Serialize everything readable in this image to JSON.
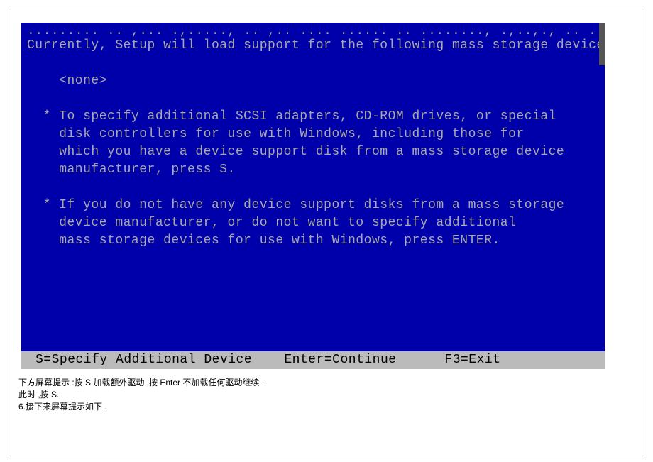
{
  "setup": {
    "cutoff": "......... .. ,... .,....., .. ,.. .... ...... .. ........, .,..,., .. ..,....",
    "line1": "Currently, Setup will load support for the following mass storage devices(s):",
    "line2": "    <none>",
    "bullet1_1": "  * To specify additional SCSI adapters, CD-ROM drives, or special",
    "bullet1_2": "    disk controllers for use with Windows, including those for",
    "bullet1_3": "    which you have a device support disk from a mass storage device",
    "bullet1_4": "    manufacturer, press S.",
    "bullet2_1": "  * If you do not have any device support disks from a mass storage",
    "bullet2_2": "    device manufacturer, or do not want to specify additional",
    "bullet2_3": "    mass storage devices for use with Windows, press ENTER.",
    "statusbar": "S=Specify Additional Device    Enter=Continue      F3=Exit"
  },
  "captions": {
    "c1": "下方屏幕提示  :按 S 加载额外驱动   ,按 Enter 不加载任何驱动继续   .",
    "c2": "此时 ,按 S.",
    "c3": "6.接下来屏幕提示如下   ."
  }
}
